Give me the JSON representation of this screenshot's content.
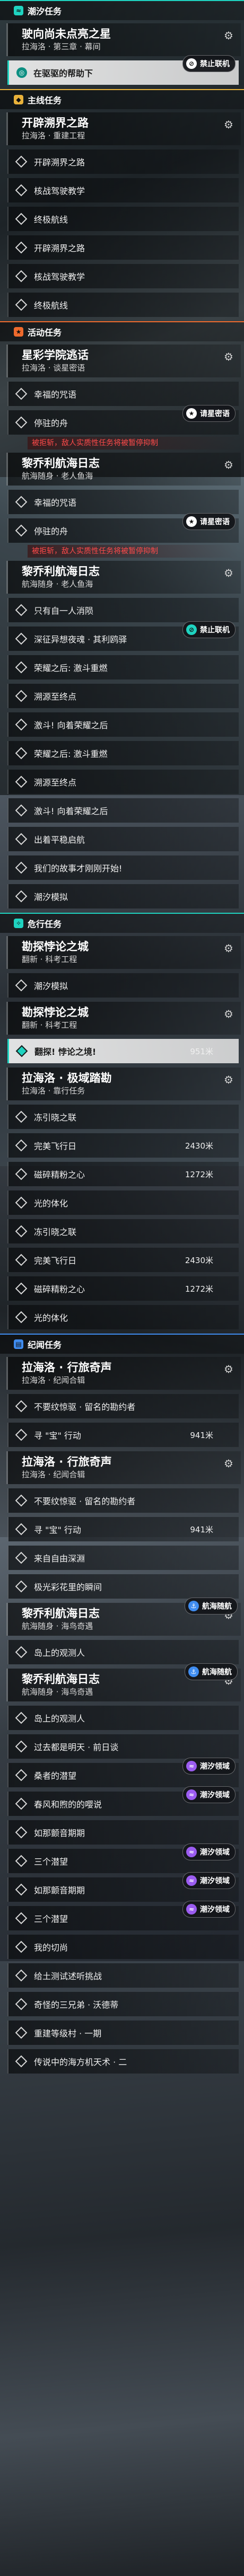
{
  "sections": [
    {
      "type": "cat",
      "name": "category-tide",
      "color": "teal",
      "icon": "wave-icon",
      "label": "潮汐任务"
    },
    {
      "type": "quest",
      "title": "驶向尚未点亮之星",
      "sub": "拉海洛 · 第三章 · 幕间"
    },
    {
      "type": "obj",
      "text": "在驱驱的帮助下",
      "highlight": true,
      "badge": {
        "text": "禁止联机",
        "style": "white",
        "icon": "ban-icon"
      }
    },
    {
      "type": "cat",
      "name": "category-main",
      "color": "gold",
      "icon": "diamond-icon",
      "label": "主线任务"
    },
    {
      "type": "quest",
      "title": "开辟溯界之路",
      "sub": "拉海洛 · 重建工程"
    },
    {
      "type": "obj",
      "text": "开辟溯界之路"
    },
    {
      "type": "obj",
      "text": "核战驾驶教学"
    },
    {
      "type": "obj",
      "text": "终极航线"
    },
    {
      "type": "obj",
      "text": "开辟溯界之路"
    },
    {
      "type": "obj",
      "text": "核战驾驶教学"
    },
    {
      "type": "obj",
      "text": "终极航线"
    },
    {
      "type": "cat",
      "name": "category-event",
      "color": "orange",
      "icon": "star-icon",
      "label": "活动任务"
    },
    {
      "type": "quest",
      "title": "星彩学院逃话",
      "sub": "拉海洛 · 谈星密语"
    },
    {
      "type": "obj",
      "text": "幸福的咒语"
    },
    {
      "type": "obj",
      "text": "停驻的舟",
      "badge": {
        "text": "请星密语",
        "style": "white",
        "icon": "star-icon"
      }
    },
    {
      "type": "warn",
      "text": "被拒斩，敌人实质性任务将被暂停抑制"
    },
    {
      "type": "quest",
      "title": "黎乔利航海日志",
      "sub": "航海随身 · 老人鱼海"
    },
    {
      "type": "obj",
      "text": "幸福的咒语"
    },
    {
      "type": "obj",
      "text": "停驻的舟",
      "badge": {
        "text": "请星密语",
        "style": "white",
        "icon": "star-icon"
      }
    },
    {
      "type": "warn",
      "text": "被拒斩，敌人实质性任务将被暂停抑制"
    },
    {
      "type": "quest",
      "title": "黎乔利航海日志",
      "sub": "航海随身 · 老人鱼海"
    },
    {
      "type": "obj",
      "text": "只有自一人消陨"
    },
    {
      "type": "obj",
      "text": "深征异想夜魂 · 其利鸥驿",
      "badge": {
        "text": "禁止联机",
        "style": "teal",
        "icon": "ban-icon"
      }
    },
    {
      "type": "obj",
      "text": "荣耀之后: 激斗重燃"
    },
    {
      "type": "obj",
      "text": "溯源至终点"
    },
    {
      "type": "obj",
      "text": "激斗! 向着荣耀之后"
    },
    {
      "type": "obj",
      "text": "荣耀之后: 激斗重燃"
    },
    {
      "type": "obj",
      "text": "溯源至终点"
    },
    {
      "type": "obj",
      "text": "激斗! 向着荣耀之后"
    },
    {
      "type": "obj",
      "text": "出着平稳启航"
    },
    {
      "type": "obj",
      "text": "我们的故事才刚刚开始!"
    },
    {
      "type": "obj",
      "text": "潮汐模拟"
    },
    {
      "type": "cat",
      "name": "category-exploration",
      "color": "teal",
      "icon": "compass-icon",
      "label": "危行任务"
    },
    {
      "type": "quest",
      "title": "勘探悖论之城",
      "sub": "翻新 · 科考工程"
    },
    {
      "type": "obj",
      "text": "潮汐模拟"
    },
    {
      "type": "quest",
      "title": "勘探悖论之城",
      "sub": "翻新 · 科考工程"
    },
    {
      "type": "obj",
      "text": "翻探! 悖论之境!",
      "count": "951米",
      "highlight": true
    },
    {
      "type": "quest",
      "title": "拉海洛 · 极域踏勘",
      "sub": "拉海洛 · 靠行任务"
    },
    {
      "type": "obj",
      "text": "冻引晓之联"
    },
    {
      "type": "obj",
      "text": "完美飞行日",
      "count": "2430米"
    },
    {
      "type": "obj",
      "text": "磁碎精粉之心",
      "count": "1272米"
    },
    {
      "type": "obj",
      "text": "光的体化"
    },
    {
      "type": "obj",
      "text": "冻引晓之联"
    },
    {
      "type": "obj",
      "text": "完美飞行日",
      "count": "2430米"
    },
    {
      "type": "obj",
      "text": "磁碎精粉之心",
      "count": "1272米"
    },
    {
      "type": "obj",
      "text": "光的体化"
    },
    {
      "type": "cat",
      "name": "category-chronicle",
      "color": "blue",
      "icon": "book-icon",
      "label": "纪闻任务"
    },
    {
      "type": "quest",
      "title": "拉海洛 · 行旅奇声",
      "sub": "拉海洛 · 纪闻合辑"
    },
    {
      "type": "obj",
      "text": "不要纹惊驱 · 留名的勘约者"
    },
    {
      "type": "obj",
      "text": "寻 \"宝\" 行动",
      "count": "941米"
    },
    {
      "type": "quest",
      "title": "拉海洛 · 行旅奇声",
      "sub": "拉海洛 · 纪闻合辑"
    },
    {
      "type": "obj",
      "text": "不要纹惊驱 · 留名的勘约者"
    },
    {
      "type": "obj",
      "text": "寻 \"宝\" 行动",
      "count": "941米"
    },
    {
      "type": "obj",
      "text": "来自自由深淵"
    },
    {
      "type": "obj",
      "text": "极光彩花里的瞬间"
    },
    {
      "type": "quest",
      "title": "黎乔利航海日志",
      "sub": "航海随身 · 海鸟奇遇",
      "badge": {
        "text": "航海随航",
        "style": "blue",
        "icon": "ship-icon"
      }
    },
    {
      "type": "obj",
      "text": "岛上的观测人"
    },
    {
      "type": "quest",
      "title": "黎乔利航海日志",
      "sub": "航海随身 · 海鸟奇遇",
      "badge": {
        "text": "航海随航",
        "style": "blue",
        "icon": "ship-icon"
      }
    },
    {
      "type": "obj",
      "text": "岛上的观测人"
    },
    {
      "type": "obj",
      "text": "过去都是明天 · 前日谈"
    },
    {
      "type": "obj",
      "text": "桑者的潜望",
      "badge": {
        "text": "潮汐领域",
        "style": "purple",
        "icon": "wave-icon"
      }
    },
    {
      "type": "obj",
      "text": "春风和煦的的嘤说",
      "badge": {
        "text": "潮汐领域",
        "style": "purple",
        "icon": "wave-icon"
      }
    },
    {
      "type": "obj",
      "text": "如那颤音期期"
    },
    {
      "type": "obj",
      "text": "三个潜望",
      "badge": {
        "text": "潮汐领域",
        "style": "purple",
        "icon": "wave-icon"
      }
    },
    {
      "type": "obj",
      "text": "如那颤音期期",
      "badge": {
        "text": "潮汐领域",
        "style": "purple",
        "icon": "wave-icon"
      }
    },
    {
      "type": "obj",
      "text": "三个潜望",
      "badge": {
        "text": "潮汐领域",
        "style": "purple",
        "icon": "wave-icon"
      }
    },
    {
      "type": "obj",
      "text": "我的切尚"
    },
    {
      "type": "obj",
      "text": "给土测试述听挑战"
    },
    {
      "type": "obj",
      "text": "奇怪的三兄弟 · 沃德蒂"
    },
    {
      "type": "obj",
      "text": "重建等级村 · 一期"
    },
    {
      "type": "obj",
      "text": "传说中的海方机天术 · 二"
    }
  ]
}
